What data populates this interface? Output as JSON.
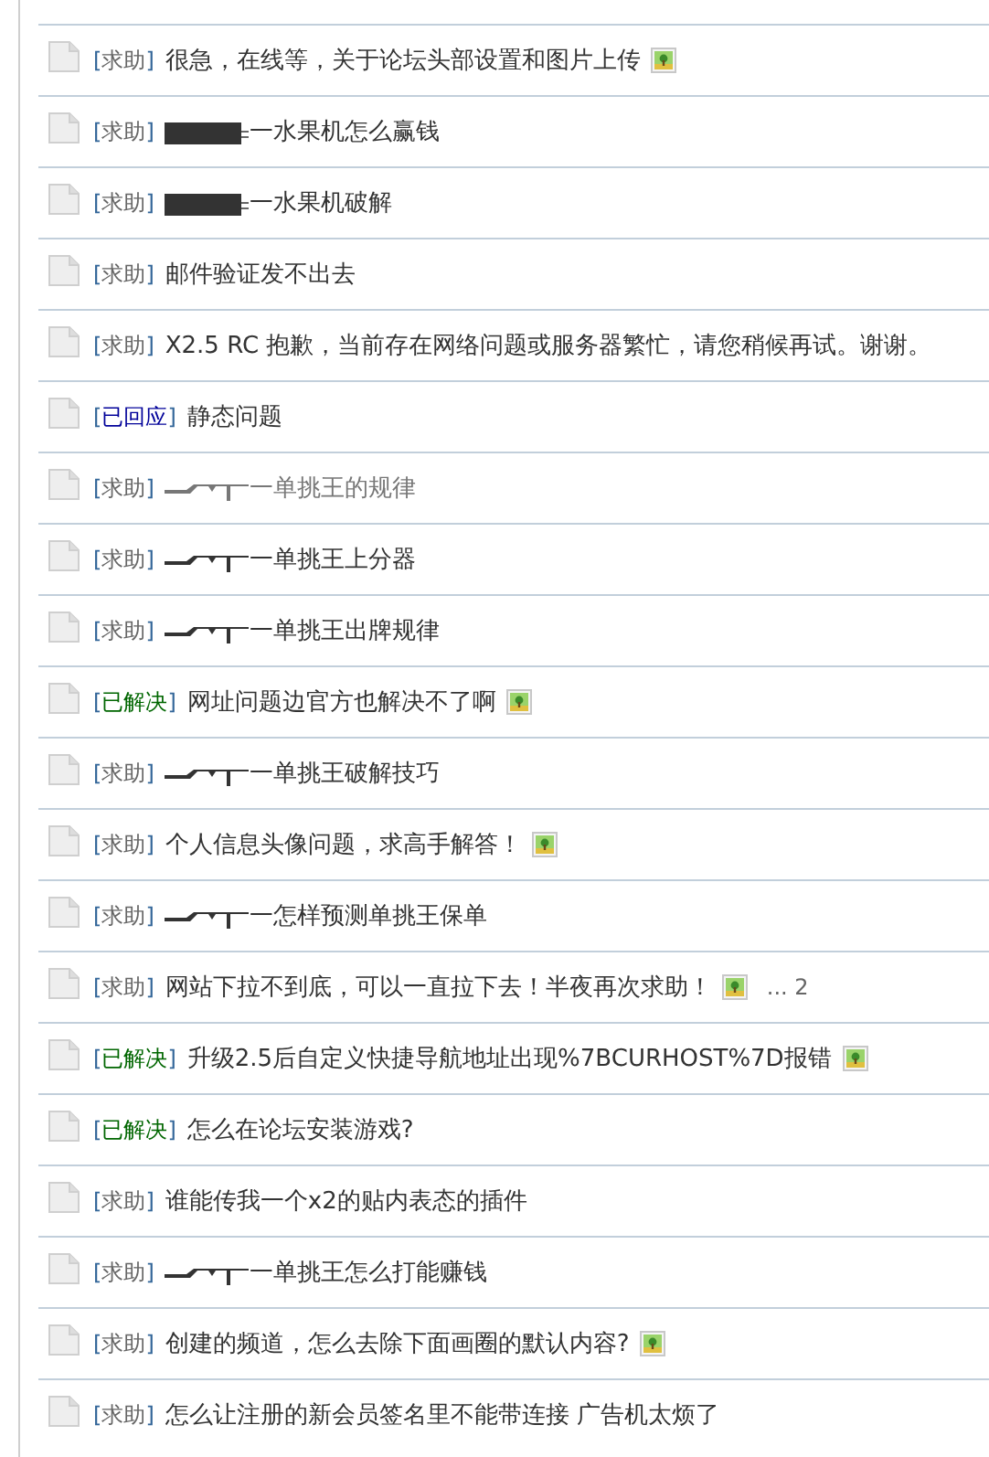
{
  "threads": [
    {
      "tag": {
        "kind": "help",
        "label": "[求助]"
      },
      "title": "很急，在线等，关于论坛头部设置和图片上传",
      "visited": false,
      "attachment": true
    },
    {
      "tag": {
        "kind": "help",
        "label": "[求助]"
      },
      "kind": "block",
      "title": "一水果机怎么赢钱",
      "visited": false,
      "attachment": false
    },
    {
      "tag": {
        "kind": "help",
        "label": "[求助]"
      },
      "kind": "block",
      "title": "一水果机破解",
      "visited": false,
      "attachment": false
    },
    {
      "tag": {
        "kind": "help",
        "label": "[求助]"
      },
      "title": "邮件验证发不出去",
      "visited": false,
      "attachment": false
    },
    {
      "tag": {
        "kind": "help",
        "label": "[求助]"
      },
      "title": "X2.5 RC 抱歉，当前存在网络问题或服务器繁忙，请您稍候再试。谢谢。",
      "visited": false,
      "attachment": false
    },
    {
      "tag": {
        "kind": "replied",
        "label": "[已回应]"
      },
      "title": "静态问题",
      "visited": false,
      "attachment": false
    },
    {
      "tag": {
        "kind": "help",
        "label": "[求助]"
      },
      "kind": "gun",
      "title": "一单挑王的规律",
      "visited": true,
      "attachment": false
    },
    {
      "tag": {
        "kind": "help",
        "label": "[求助]"
      },
      "kind": "gun",
      "title": "一单挑王上分器",
      "visited": false,
      "attachment": false
    },
    {
      "tag": {
        "kind": "help",
        "label": "[求助]"
      },
      "kind": "gun",
      "title": "一单挑王出牌规律",
      "visited": false,
      "attachment": false
    },
    {
      "tag": {
        "kind": "solved",
        "label": "[已解决]"
      },
      "title": "网址问题边官方也解决不了啊",
      "visited": false,
      "attachment": true
    },
    {
      "tag": {
        "kind": "help",
        "label": "[求助]"
      },
      "kind": "gun",
      "title": "一单挑王破解技巧",
      "visited": false,
      "attachment": false
    },
    {
      "tag": {
        "kind": "help",
        "label": "[求助]"
      },
      "title": "个人信息头像问题，求高手解答！",
      "visited": false,
      "attachment": true
    },
    {
      "tag": {
        "kind": "help",
        "label": "[求助]"
      },
      "kind": "gun",
      "title": "一怎样预测单挑王保单",
      "visited": false,
      "attachment": false
    },
    {
      "tag": {
        "kind": "help",
        "label": "[求助]"
      },
      "title": "网站下拉不到底，可以一直拉下去！半夜再次求助！",
      "visited": false,
      "attachment": true,
      "pages": "... 2"
    },
    {
      "tag": {
        "kind": "solved",
        "label": "[已解决]"
      },
      "title": "升级2.5后自定义快捷导航地址出现%7BCURHOST%7D报错",
      "visited": false,
      "attachment": true
    },
    {
      "tag": {
        "kind": "solved",
        "label": "[已解决]"
      },
      "title": "怎么在论坛安装游戏?",
      "visited": false,
      "attachment": false
    },
    {
      "tag": {
        "kind": "help",
        "label": "[求助]"
      },
      "title": "谁能传我一个x2的贴内表态的插件",
      "visited": false,
      "attachment": false
    },
    {
      "tag": {
        "kind": "help",
        "label": "[求助]"
      },
      "kind": "gun",
      "title": "一单挑王怎么打能赚钱",
      "visited": false,
      "attachment": false
    },
    {
      "tag": {
        "kind": "help",
        "label": "[求助]"
      },
      "title": "创建的频道，怎么去除下面画圈的默认内容?",
      "visited": false,
      "attachment": true
    },
    {
      "tag": {
        "kind": "help",
        "label": "[求助]"
      },
      "title": "怎么让注册的新会员签名里不能带连接 广告机太烦了",
      "visited": false,
      "attachment": false
    }
  ]
}
